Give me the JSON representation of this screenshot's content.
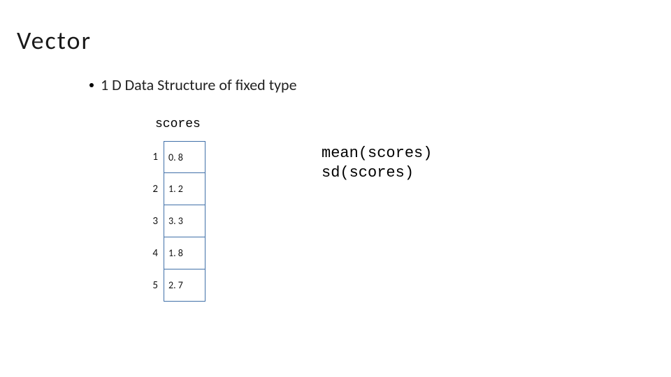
{
  "title": "Vector",
  "bullet_text": "1 D Data Structure of fixed type",
  "vector_label": "scores",
  "vector": [
    {
      "index": "1",
      "value": "0. 8"
    },
    {
      "index": "2",
      "value": "1. 2"
    },
    {
      "index": "3",
      "value": "3. 3"
    },
    {
      "index": "4",
      "value": "1. 8"
    },
    {
      "index": "5",
      "value": "2. 7"
    }
  ],
  "code_lines": {
    "line1": "mean(scores)",
    "line2": "sd(scores)"
  }
}
